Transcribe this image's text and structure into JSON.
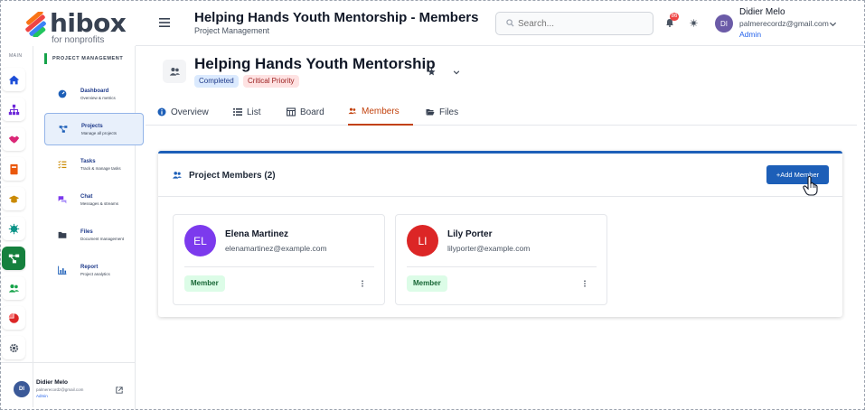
{
  "brand": {
    "name": "hibox",
    "tagline": "for nonprofits"
  },
  "rail": {
    "label": "MAIN",
    "buttons": [
      {
        "icon": "home-icon",
        "color": "#1d4ed8"
      },
      {
        "icon": "sitemap-icon",
        "color": "#6d28d9"
      },
      {
        "icon": "handshake-icon",
        "color": "#db2777"
      },
      {
        "icon": "book-icon",
        "color": "#ea580c"
      },
      {
        "icon": "graduation-cap-icon",
        "color": "#ca8a04"
      },
      {
        "icon": "virus-icon",
        "color": "#0d9488"
      },
      {
        "icon": "project-diagram-icon",
        "color": "#ffffff",
        "active": true
      },
      {
        "icon": "users-icon",
        "color": "#16a34a"
      },
      {
        "icon": "pie-chart-icon",
        "color": "#dc2626"
      },
      {
        "icon": "gear-icon",
        "color": "#4b5563"
      }
    ]
  },
  "panel": {
    "heading": "PROJECT MANAGEMENT",
    "items": [
      {
        "title": "Dashboard",
        "desc": "Overview & metrics",
        "icon": "gauge-icon"
      },
      {
        "title": "Projects",
        "desc": "Manage all projects",
        "icon": "project-diagram-icon"
      },
      {
        "title": "Tasks",
        "desc": "Track & manage tasks",
        "icon": "tasks-icon"
      },
      {
        "title": "Chat",
        "desc": "Messages & streams",
        "icon": "chat-icon"
      },
      {
        "title": "Files",
        "desc": "Document management",
        "icon": "folder-icon"
      },
      {
        "title": "Report",
        "desc": "Project analytics",
        "icon": "chart-icon"
      }
    ],
    "user": {
      "initials": "DI",
      "name": "Didier Melo",
      "email": "palmerecordz@gmail.com",
      "role": "Admin"
    }
  },
  "header": {
    "title": "Helping Hands Youth Mentorship - Members",
    "subtitle": "Project Management",
    "search_placeholder": "Search...",
    "notifications": "86",
    "user": {
      "initials": "DI",
      "name": "Didier Melo",
      "email": "palmerecordz@gmail.com",
      "role": "Admin"
    }
  },
  "project": {
    "title": "Helping Hands Youth Mentorship",
    "status": "Completed",
    "priority": "Critical Priority"
  },
  "tabs": [
    {
      "label": "Overview",
      "icon": "info-icon"
    },
    {
      "label": "List",
      "icon": "list-icon"
    },
    {
      "label": "Board",
      "icon": "board-icon"
    },
    {
      "label": "Members",
      "icon": "users-icon",
      "active": true
    },
    {
      "label": "Files",
      "icon": "folder-open-icon"
    }
  ],
  "members_section": {
    "title": "Project Members (2)",
    "add_button": "+Add Member",
    "members": [
      {
        "initials": "EL",
        "name": "Elena Martinez",
        "email": "elenamartinez@example.com",
        "role": "Member",
        "color": "#7c3aed"
      },
      {
        "initials": "LI",
        "name": "Lily Porter",
        "email": "lilyporter@example.com",
        "role": "Member",
        "color": "#dc2626"
      }
    ]
  },
  "colors": {
    "accent": "#1d5fb8",
    "active_tab": "#c2410c",
    "brand_green": "#16a34a"
  }
}
